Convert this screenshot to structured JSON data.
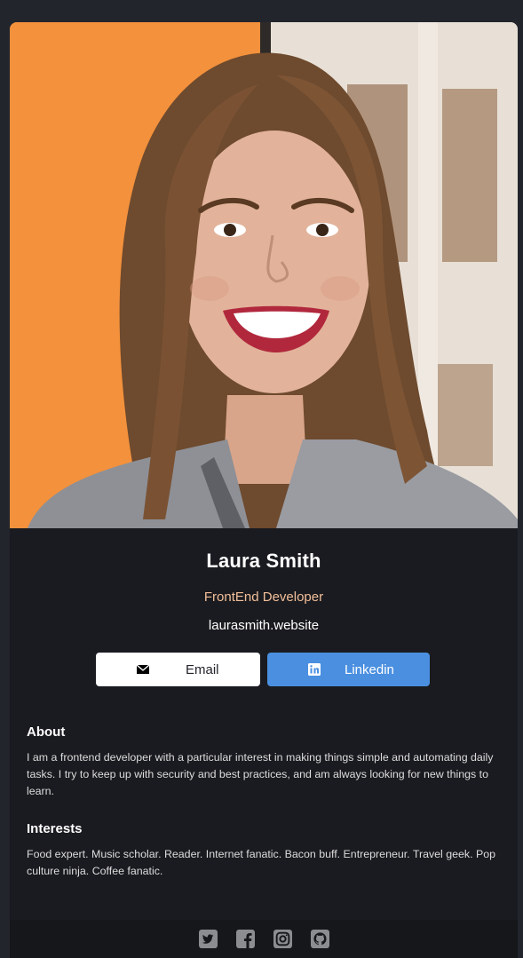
{
  "profile": {
    "name": "Laura Smith",
    "role": "FrontEnd Developer",
    "website": "laurasmith.website"
  },
  "buttons": {
    "email_label": "Email",
    "linkedin_label": "Linkedin"
  },
  "about": {
    "heading": "About",
    "text": "I am a frontend developer with a particular interest in making things simple and automating daily tasks. I try to keep up with security and best practices, and am always looking for new things to learn."
  },
  "interests": {
    "heading": "Interests",
    "text": "Food expert. Music scholar. Reader. Internet fanatic. Bacon buff. Entrepreneur. Travel geek. Pop culture ninja. Coffee fanatic."
  },
  "footer": {
    "icons": [
      "twitter-icon",
      "facebook-icon",
      "instagram-icon",
      "github-icon"
    ]
  },
  "colors": {
    "background": "#23252c",
    "card": "#1a1b20",
    "accent_role": "#f3bf99",
    "linkedin_button": "#4a8fe0",
    "footer": "#16171b"
  }
}
